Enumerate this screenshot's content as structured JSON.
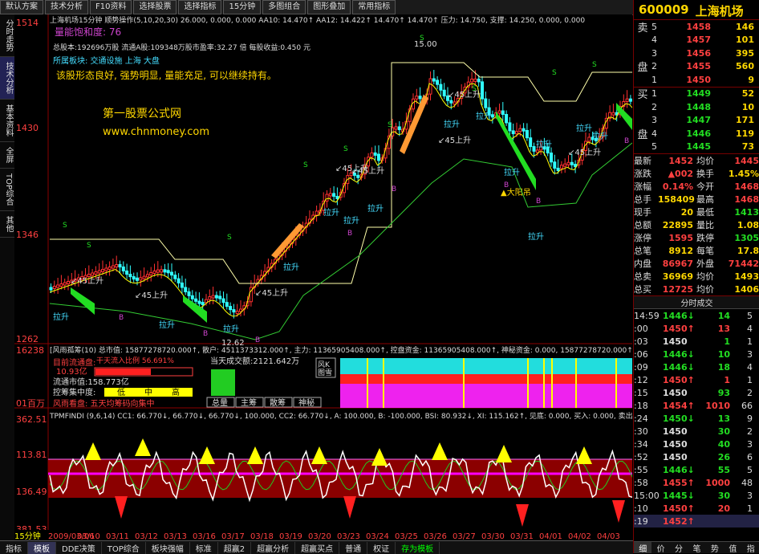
{
  "topbar": {
    "buttons": [
      "默认方案",
      "技术分析",
      "F10资料",
      "选择股票",
      "选择指标",
      "15分钟",
      "多图组合",
      "图形叠加",
      "常用指标"
    ],
    "right_buttons": [
      "标",
      "⊞",
      "权",
      "缩",
      "⊖",
      "⊕"
    ]
  },
  "leftnav": [
    "分时走势",
    "技术分析",
    "基本资料",
    "全屏",
    "TOP综合",
    "其他"
  ],
  "main_chart": {
    "header": "上海机场15分钟 顺势操作(5,10,20,30) 26.000, 0.000, 0.000 AA10: 14.470↑ AA12: 14.422↑ 14.470↑ 14.470↑ 压力: 14.750, 支撑: 14.250, 0.000, 0.000",
    "line1": "量能饱和度: 76",
    "line2": "总股本:192696万股 流通A股:109348万股市盈率:32.27 倍 每股收益:0.450 元",
    "line3": "所属板块: 交通设施 上海 大盘",
    "line4": "该股形态良好, 强势明显, 量能充足, 可以继续持有。",
    "watermark1": "第一股票公式网",
    "watermark2": "www.chnmoney.com",
    "y_labels": [
      "1514",
      "1430",
      "1346",
      "1262"
    ],
    "peak_label": "15.00",
    "low_label": "12.62",
    "big_up_label": "▲大阳吊",
    "annotations": [
      "45上升",
      "45上升",
      "45上升",
      "45上升",
      "45上升",
      "45上升",
      "45上升",
      "45上升"
    ],
    "ladder": [
      "拉升",
      "拉升",
      "拉升",
      "拉升",
      "拉升",
      "拉升",
      "拉升",
      "拉升",
      "拉升",
      "拉升",
      "拉升",
      "拉升",
      "拉升",
      "拉升"
    ]
  },
  "mid_panel": {
    "header": "[风雨孤筹(10) 总市值: 15877278720.000↑, 散户: 4511373312.000↑, 主力: 11365905408.000↑, 控盘资金: 11365905408.000↑, 神秘资金: 0.000, 15877278720.000↑",
    "y_top": "16238",
    "y_bottom": "01百万",
    "flow_title": "目前流通盘:",
    "flow_value": "10.93亿",
    "flow_pct": "干天流入比例 56.691%",
    "mcap": "流通市值:158.773亿",
    "concentration": "控筹集中度:",
    "conc_labels": [
      "低",
      "中",
      "高"
    ],
    "conclusion": "风雨看盘: 五天均筹码向集中",
    "today_volume": "当天成交额:2121.642万",
    "vol_buttons": [
      "总量",
      "主筹",
      "散筹",
      "神秘"
    ],
    "wind_label": "风K图雪"
  },
  "osc_panel": {
    "header": "TPMFINDI (9,6,14) CC1: 66.770↓, 66.770↓, 66.770↓, 100.000, CC2: 66.770↓, A: 100.000, B: -100.000, BSI: 80.932↓, XI: 115.162↑, 见底: 0.000, 买入: 0.000, 卖出",
    "y_labels": [
      "362.51",
      "113.81",
      "136.49",
      "381.53"
    ],
    "x_labels": [
      "15分钟",
      "2009/03/06",
      "03/10",
      "03/11",
      "03/12",
      "03/13",
      "03/16",
      "03/17",
      "03/18",
      "03/19",
      "03/20",
      "03/23",
      "03/24",
      "03/25",
      "03/26",
      "03/27",
      "03/30",
      "03/31",
      "04/01",
      "04/02",
      "04/03"
    ]
  },
  "bottombar": [
    "指标",
    "模板",
    "DDE决策",
    "TOP综合",
    "板块强幅",
    "标准",
    "超赢2",
    "超赢分析",
    "超赢买点",
    "普通",
    "权证",
    "存为模板"
  ],
  "right_panel": {
    "code": "600009",
    "name": "上海机场",
    "sell_label": [
      "卖",
      "盘"
    ],
    "buy_label": [
      "买",
      "盘"
    ],
    "asks": [
      {
        "level": "5",
        "price": "1458",
        "vol": "146"
      },
      {
        "level": "4",
        "price": "1457",
        "vol": "101"
      },
      {
        "level": "3",
        "price": "1456",
        "vol": "395"
      },
      {
        "level": "2",
        "price": "1455",
        "vol": "560"
      },
      {
        "level": "1",
        "price": "1450",
        "vol": "9"
      }
    ],
    "bids": [
      {
        "level": "1",
        "price": "1449",
        "vol": "52"
      },
      {
        "level": "2",
        "price": "1448",
        "vol": "10"
      },
      {
        "level": "3",
        "price": "1447",
        "vol": "171"
      },
      {
        "level": "4",
        "price": "1446",
        "vol": "119"
      },
      {
        "level": "5",
        "price": "1445",
        "vol": "73"
      }
    ],
    "stats": [
      {
        "l1": "最新",
        "v1": "1452",
        "l2": "均价",
        "v2": "1445"
      },
      {
        "l1": "涨跌",
        "v1": "▲002",
        "l2": "换手",
        "v2": "1.45%"
      },
      {
        "l1": "涨幅",
        "v1": "0.14%",
        "l2": "今开",
        "v2": "1468"
      },
      {
        "l1": "总手",
        "v1": "158409",
        "l2": "最高",
        "v2": "1468"
      },
      {
        "l1": "现手",
        "v1": "20",
        "l2": "最低",
        "v2": "1413"
      },
      {
        "l1": "总额",
        "v1": "22895",
        "l2": "量比",
        "v2": "1.08"
      },
      {
        "l1": "涨停",
        "v1": "1595",
        "l2": "跌停",
        "v2": "1305"
      },
      {
        "l1": "总笔",
        "v1": "8912",
        "l2": "每笔",
        "v2": "17.8"
      },
      {
        "l1": "内盘",
        "v1": "86967",
        "l2": "外盘",
        "v2": "71442"
      },
      {
        "l1": "总卖",
        "v1": "36969",
        "l2": "均价",
        "v2": "1493"
      },
      {
        "l1": "总买",
        "v1": "12725",
        "l2": "均价",
        "v2": "1406"
      }
    ],
    "ticks_header": "分时成交",
    "ticks": [
      {
        "time": "14:59",
        "price": "1446",
        "dir": "↓",
        "vol": "14",
        "n": "5"
      },
      {
        "time": ":00",
        "price": "1450",
        "dir": "↑",
        "vol": "13",
        "n": "4"
      },
      {
        "time": ":03",
        "price": "1450",
        "dir": "",
        "vol": "1",
        "n": "1"
      },
      {
        "time": ":06",
        "price": "1446",
        "dir": "↓",
        "vol": "10",
        "n": "3"
      },
      {
        "time": ":09",
        "price": "1446",
        "dir": "↓",
        "vol": "18",
        "n": "4"
      },
      {
        "time": ":12",
        "price": "1450",
        "dir": "↑",
        "vol": "1",
        "n": "1"
      },
      {
        "time": ":15",
        "price": "1450",
        "dir": "",
        "vol": "93",
        "n": "2"
      },
      {
        "time": ":18",
        "price": "1454",
        "dir": "↑",
        "vol": "1010",
        "n": "66"
      },
      {
        "time": ":24",
        "price": "1450",
        "dir": "↓",
        "vol": "13",
        "n": "9"
      },
      {
        "time": ":30",
        "price": "1450",
        "dir": "",
        "vol": "30",
        "n": "2"
      },
      {
        "time": ":34",
        "price": "1450",
        "dir": "",
        "vol": "40",
        "n": "3"
      },
      {
        "time": ":52",
        "price": "1450",
        "dir": "",
        "vol": "26",
        "n": "6"
      },
      {
        "time": ":55",
        "price": "1446",
        "dir": "↓",
        "vol": "55",
        "n": "5"
      },
      {
        "time": ":58",
        "price": "1455",
        "dir": "↑",
        "vol": "1000",
        "n": "48"
      },
      {
        "time": "15:00",
        "price": "1445",
        "dir": "↓",
        "vol": "30",
        "n": "3"
      },
      {
        "time": ":10",
        "price": "1450",
        "dir": "↑",
        "vol": "20",
        "n": "1"
      },
      {
        "time": ":19",
        "price": "1452",
        "dir": "↑",
        "vol": "",
        "n": ""
      }
    ],
    "tabs": [
      "细",
      "价",
      "分",
      "笔",
      "势",
      "值",
      "指"
    ]
  }
}
